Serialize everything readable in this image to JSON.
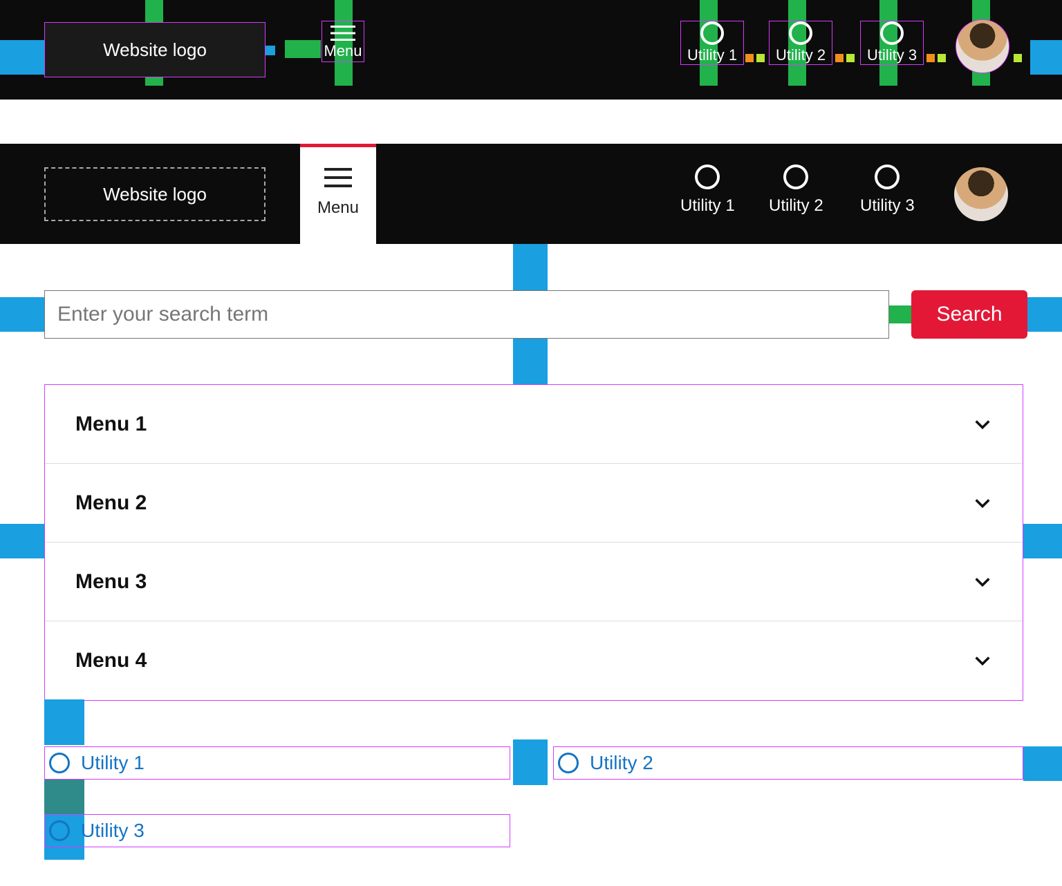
{
  "header_annotated": {
    "logo_label": "Website logo",
    "menu_label": "Menu",
    "utilities": [
      "Utility 1",
      "Utility 2",
      "Utility 3"
    ]
  },
  "header_live": {
    "logo_label": "Website logo",
    "menu_label": "Menu",
    "utilities": [
      "Utility 1",
      "Utility 2",
      "Utility 3"
    ]
  },
  "search": {
    "placeholder": "Enter your search term",
    "button_label": "Search"
  },
  "menu_items": [
    "Menu 1",
    "Menu 2",
    "Menu 3",
    "Menu 4"
  ],
  "bottom_utilities": [
    "Utility 1",
    "Utility 2",
    "Utility 3"
  ]
}
